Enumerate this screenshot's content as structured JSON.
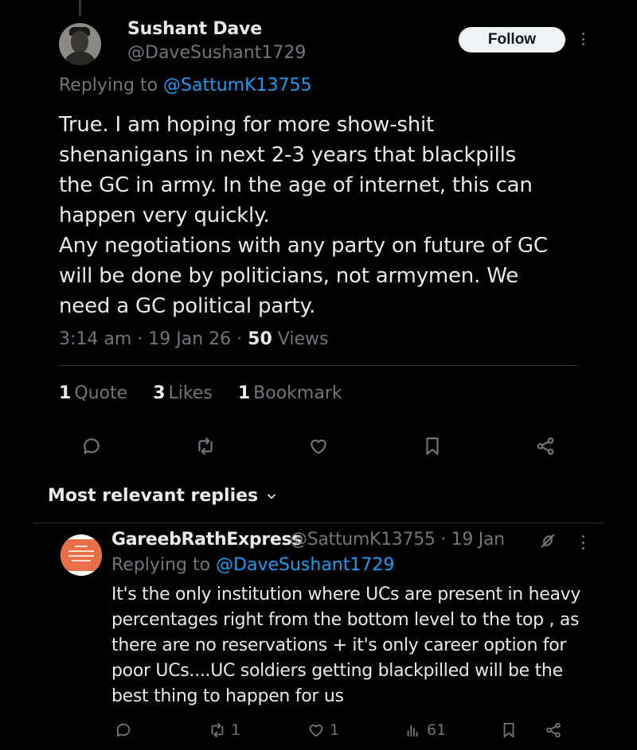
{
  "tweet": {
    "author_name": "Sushant Dave",
    "author_handle": "@DaveSushant1729",
    "follow_label": "Follow",
    "replying_prefix": "Replying to",
    "replying_to": "@SattumK13755",
    "text": "True. I am hoping for more show-shit\nshenanigans in next 2-3 years that blackpills\nthe GC in army. In the age of internet, this can\nhappen very quickly.\nAny negotiations with any party on future of GC\nwill be done by politicians, not armymen. We\nneed a GC political party.",
    "time": "3:14 am · 19 Jan 26 · ",
    "views_count": "50",
    "views_label": " Views",
    "stats": [
      {
        "num": "1",
        "label": "Quote"
      },
      {
        "num": "3",
        "label": "Likes"
      },
      {
        "num": "1",
        "label": "Bookmark"
      }
    ],
    "actions": [
      "reply-icon",
      "retweet-icon",
      "like-icon",
      "bookmark-icon",
      "share-icon"
    ]
  },
  "replies_sort": {
    "label": "Most relevant replies"
  },
  "reply": {
    "author_name": "GareebRathExpress",
    "author_handle": "@SattumK13755 · 19 Jan",
    "replying_prefix": "Replying to",
    "replying_to": "@DaveSushant1729",
    "text": "It's the only institution where UCs are present in heavy percentages right from the bottom level to the top , as there are no reservations + it's only career option for poor UCs....UC soldiers getting blackpilled will be the best thing to happen for us",
    "retweets": "1",
    "likes": "1",
    "views": "61"
  },
  "colors": {
    "background": "#000000",
    "text": "#e7e9ea",
    "muted": "#71767b",
    "link": "#1d9bf0",
    "divider": "#2f3336"
  }
}
